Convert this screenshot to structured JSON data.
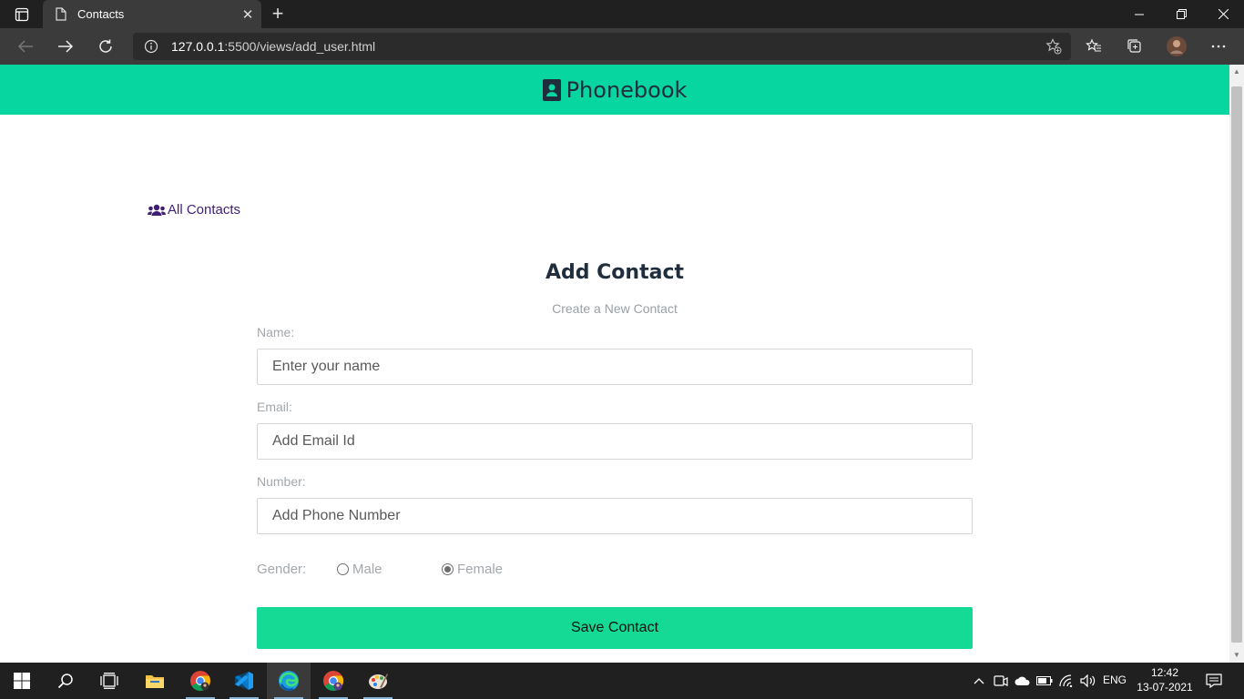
{
  "browser": {
    "tab_title": "Contacts",
    "new_tab_label": "+",
    "url_host": "127.0.0.1",
    "url_rest": ":5500/views/add_user.html"
  },
  "header": {
    "brand": "Phonebook",
    "color": "#08d6a0"
  },
  "nav": {
    "all_contacts": "All Contacts"
  },
  "form": {
    "title": "Add Contact",
    "subtitle": "Create a New Contact",
    "name_label": "Name:",
    "name_placeholder": "Enter your name",
    "email_label": "Email:",
    "email_placeholder": "Add Email Id",
    "number_label": "Number:",
    "number_placeholder": "Add Phone Number",
    "gender_label": "Gender:",
    "gender_options": [
      "Male",
      "Female"
    ],
    "gender_selected": "Female",
    "save_label": "Save Contact",
    "save_color": "#14da95"
  },
  "taskbar": {
    "language": "ENG",
    "time": "12:42",
    "date": "13-07-2021",
    "apps": [
      "start-icon",
      "search-icon",
      "task-view-icon",
      "file-explorer-icon",
      "chrome-icon",
      "vscode-icon",
      "edge-icon",
      "chrome-profile-icon",
      "paint-icon"
    ]
  }
}
